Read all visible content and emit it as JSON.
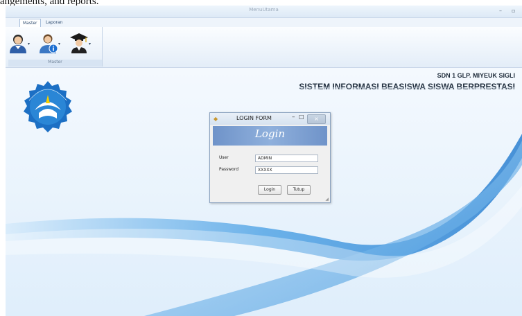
{
  "caption": "angements, and reports.",
  "window": {
    "title": "MenuUtama",
    "minimize_glyph": "–",
    "restore_glyph": "▫"
  },
  "tabs": [
    {
      "label": "Master",
      "active": true
    },
    {
      "label": "Laporan",
      "active": false
    }
  ],
  "ribbon": {
    "group_label": "Master",
    "buttons": [
      {
        "icon": "student-icon"
      },
      {
        "icon": "user-info-icon"
      },
      {
        "icon": "graduate-icon"
      }
    ],
    "dropdown_glyph": "▾"
  },
  "header": {
    "school": "SDN 1 GLP. MIYEUK SIGLI",
    "system": "SISTEM INFORMASI BEASISWA SISWA BERPRESTASI",
    "logo_text": "TUT WURI HANDAYANI"
  },
  "login_dialog": {
    "title": "LOGIN FORM",
    "banner": "Login",
    "user_label": "User",
    "user_value": "ADMIN",
    "password_label": "Password",
    "password_value": "XXXXX",
    "login_button": "Login",
    "close_button": "Tutup",
    "min_glyph": "–",
    "max_glyph": "□",
    "close_glyph": "×",
    "app_icon_glyph": "◆",
    "grip_glyph": "◢"
  },
  "colors": {
    "accent": "#4a90d9",
    "banner": "#7d9fd2",
    "background": "#eaf3fc"
  }
}
